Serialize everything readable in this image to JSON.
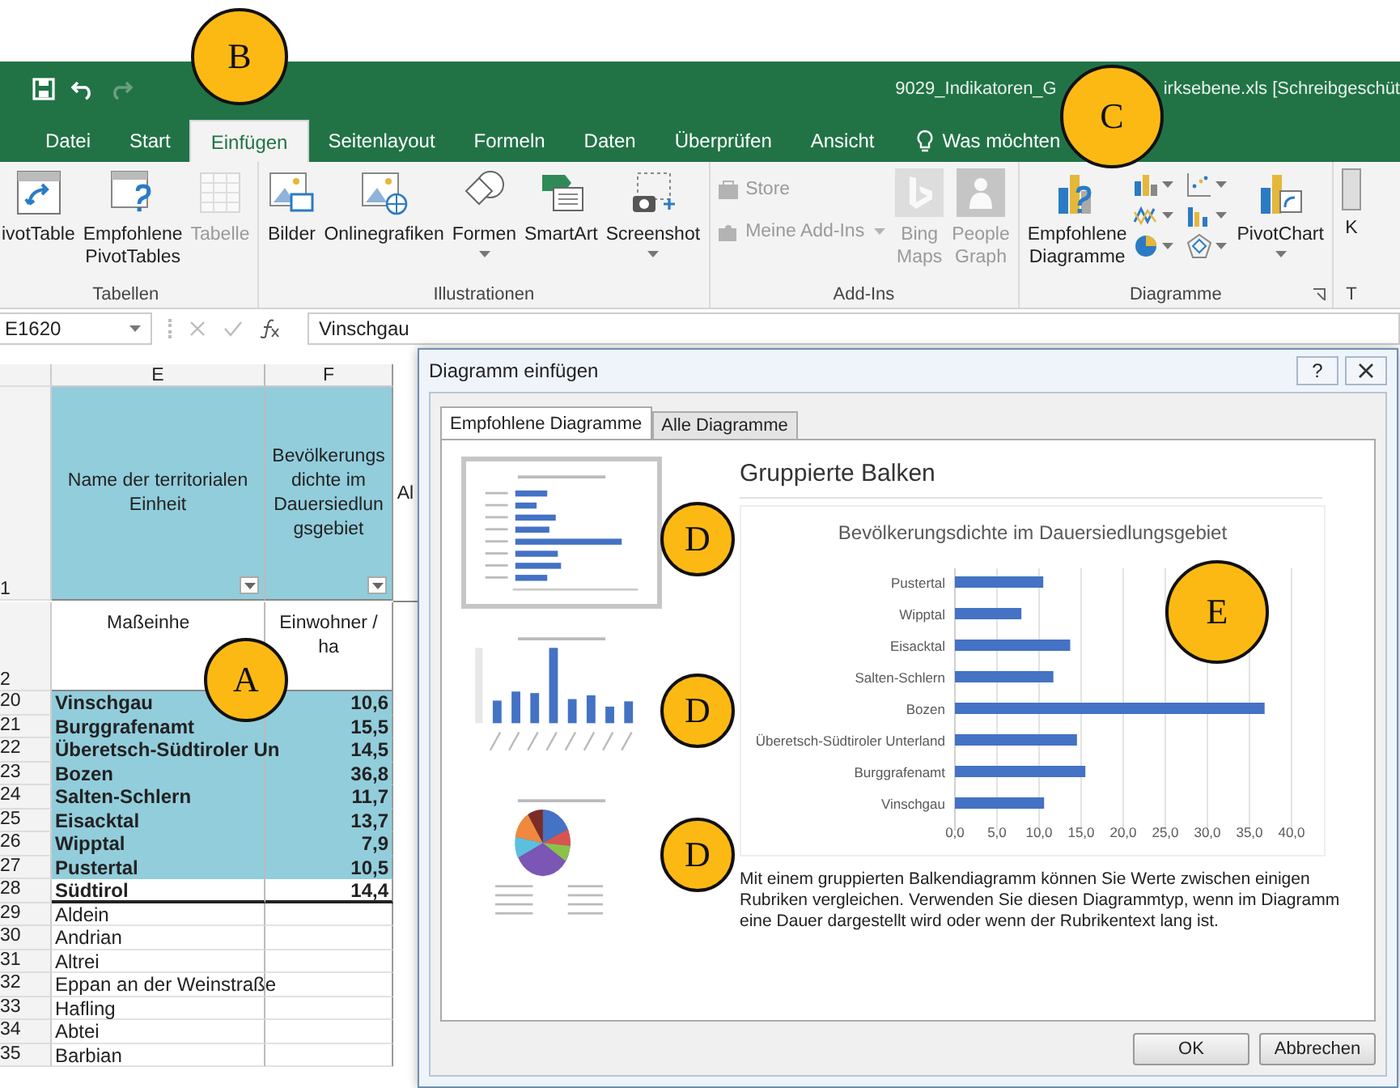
{
  "title_bar": {
    "title_parts": [
      "9029_Indikatoren_G",
      "irksebene.xls  [Schreibgeschüt"
    ]
  },
  "quick_access": [
    {
      "kind": "save",
      "disabled": false
    },
    {
      "kind": "undo",
      "disabled": false
    },
    {
      "kind": "redo",
      "disabled": true
    }
  ],
  "tabs": [
    {
      "label": "Datei",
      "selected": false
    },
    {
      "label": "Start",
      "selected": false
    },
    {
      "label": "Einfügen",
      "selected": true
    },
    {
      "label": "Seitenlayout",
      "selected": false
    },
    {
      "label": "Formeln",
      "selected": false
    },
    {
      "label": "Daten",
      "selected": false
    },
    {
      "label": "Überprüfen",
      "selected": false
    },
    {
      "label": "Ansicht",
      "selected": false
    }
  ],
  "tell_me": "Was möchten",
  "ribbon": {
    "groups": [
      {
        "label": "Tabellen",
        "items": [
          {
            "kind": "large",
            "lines": [
              "ivotTable"
            ],
            "disabled": false,
            "dropdown": false
          },
          {
            "kind": "large",
            "lines": [
              "Empfohlene",
              "PivotTables"
            ],
            "disabled": false,
            "dropdown": false
          },
          {
            "kind": "large",
            "lines": [
              "Tabelle"
            ],
            "disabled": true,
            "dropdown": false
          }
        ]
      },
      {
        "label": "Illustrationen",
        "items": [
          {
            "kind": "large",
            "lines": [
              "Bilder"
            ],
            "disabled": false,
            "dropdown": false
          },
          {
            "kind": "large",
            "lines": [
              "Onlinegrafiken"
            ],
            "disabled": false,
            "dropdown": false
          },
          {
            "kind": "large",
            "lines": [
              "Formen"
            ],
            "disabled": false,
            "dropdown": true
          },
          {
            "kind": "large",
            "lines": [
              "SmartArt"
            ],
            "disabled": false,
            "dropdown": false
          },
          {
            "kind": "large",
            "lines": [
              "Screenshot"
            ],
            "disabled": false,
            "dropdown": true
          }
        ]
      },
      {
        "label": "Add-Ins",
        "items": [
          {
            "kind": "stack",
            "disabled": true,
            "entries": [
              {
                "label": "Store",
                "dropdown": false
              },
              {
                "label": "Meine Add-Ins",
                "dropdown": true
              }
            ]
          },
          {
            "kind": "large",
            "lines": [
              "Bing",
              "Maps"
            ],
            "disabled": true,
            "dropdown": false
          },
          {
            "kind": "large",
            "lines": [
              "People",
              "Graph"
            ],
            "disabled": true,
            "dropdown": false
          }
        ]
      },
      {
        "label": "Diagramme",
        "launcher": true,
        "items": [
          {
            "kind": "large",
            "lines": [
              "Empfohlene",
              "Diagramme"
            ],
            "disabled": false,
            "dropdown": false
          },
          {
            "kind": "chart_icons"
          },
          {
            "kind": "large",
            "lines": [
              "PivotChart"
            ],
            "disabled": false,
            "dropdown": true
          }
        ]
      },
      {
        "label": "T",
        "items": [
          {
            "kind": "large",
            "lines": [
              "K"
            ],
            "disabled": false,
            "dropdown": false
          }
        ]
      }
    ]
  },
  "formula_bar": {
    "name_box": "E1620",
    "value": "Vinschgau"
  },
  "sheet": {
    "columns": [
      "E",
      "F"
    ],
    "header_rows": [
      {
        "row": "1",
        "cells": [
          [
            "Name der territorialen",
            "Einheit"
          ],
          [
            "Bevölkerungs",
            "dichte im",
            "Dauersiedlun",
            "gsgebiet"
          ],
          [
            "Al"
          ]
        ],
        "filter": true
      },
      {
        "row": "2",
        "cells": [
          [
            "Maßeinhe"
          ],
          [
            "Einwohner /",
            "ha"
          ]
        ],
        "filter": false
      }
    ],
    "rows": [
      {
        "row": "20",
        "name": "Vinschgau",
        "value": "10,6",
        "highlight": true,
        "bold": true
      },
      {
        "row": "21",
        "name": "Burggrafenamt",
        "value": "15,5",
        "highlight": true,
        "bold": true
      },
      {
        "row": "22",
        "name": "Überetsch-Südtiroler Un",
        "value": "14,5",
        "highlight": true,
        "bold": true
      },
      {
        "row": "23",
        "name": "Bozen",
        "value": "36,8",
        "highlight": true,
        "bold": true
      },
      {
        "row": "24",
        "name": "Salten-Schlern",
        "value": "11,7",
        "highlight": true,
        "bold": true
      },
      {
        "row": "25",
        "name": "Eisacktal",
        "value": "13,7",
        "highlight": true,
        "bold": true
      },
      {
        "row": "26",
        "name": "Wipptal",
        "value": "7,9",
        "highlight": true,
        "bold": true
      },
      {
        "row": "27",
        "name": "Pustertal",
        "value": "10,5",
        "highlight": true,
        "bold": true
      },
      {
        "row": "28",
        "name": "Südtirol",
        "value": "14,4",
        "highlight": false,
        "bold": true
      },
      {
        "row": "29",
        "name": "Aldein",
        "highlight": false,
        "bold": false
      },
      {
        "row": "30",
        "name": "Andrian",
        "highlight": false,
        "bold": false
      },
      {
        "row": "31",
        "name": "Altrei",
        "highlight": false,
        "bold": false
      },
      {
        "row": "32",
        "name": "Eppan an der Weinstraße",
        "highlight": false,
        "bold": false
      },
      {
        "row": "33",
        "name": "Hafling",
        "highlight": false,
        "bold": false
      },
      {
        "row": "34",
        "name": "Abtei",
        "highlight": false,
        "bold": false
      },
      {
        "row": "35",
        "name": "Barbian",
        "highlight": false,
        "bold": false
      }
    ]
  },
  "dialog": {
    "title": "Diagramm einfügen",
    "help": "?",
    "tabs": [
      {
        "label": "Empfohlene Diagramme",
        "selected": true
      },
      {
        "label": "Alle Diagramme",
        "selected": false
      }
    ],
    "thumbnails": [
      {
        "kind": "bar",
        "selected": true
      },
      {
        "kind": "column",
        "selected": false
      },
      {
        "kind": "pie",
        "selected": false
      }
    ],
    "preview": {
      "heading": "Gruppierte Balken",
      "chart_data": {
        "type": "bar",
        "orientation": "horizontal",
        "title": "Bevölkerungsdichte im Dauersiedlungsgebiet",
        "grid": true,
        "categories": [
          "Pustertal",
          "Wipptal",
          "Eisacktal",
          "Salten-Schlern",
          "Bozen",
          "Überetsch-Südtiroler Unterland",
          "Burggrafenamt",
          "Vinschgau"
        ],
        "series": [
          {
            "color": "#4472c4",
            "values": [
              10.5,
              7.9,
              13.7,
              11.7,
              36.8,
              14.5,
              15.5,
              10.6
            ]
          }
        ],
        "xlim": [
          0,
          40
        ],
        "xticks": [
          {
            "value": 0,
            "label": "0,0"
          },
          {
            "value": 5,
            "label": "5,0"
          },
          {
            "value": 10,
            "label": "10,0"
          },
          {
            "value": 15,
            "label": "15,0"
          },
          {
            "value": 20,
            "label": "20,0"
          },
          {
            "value": 25,
            "label": "25,0"
          },
          {
            "value": 30,
            "label": "30,0"
          },
          {
            "value": 35,
            "label": "35,0"
          },
          {
            "value": 40,
            "label": "40,0"
          }
        ]
      }
    },
    "description": "Mit einem gruppierten Balkendiagramm können Sie Werte zwischen einigen Rubriken vergleichen. Verwenden Sie diesen Diagrammtyp, wenn im Diagramm eine Dauer dargestellt wird oder wenn der Rubrikentext lang ist.",
    "buttons": [
      "OK",
      "Abbrechen"
    ]
  },
  "callouts": [
    {
      "letter": "B"
    },
    {
      "letter": "C"
    },
    {
      "letter": "A"
    },
    {
      "letter": "D"
    },
    {
      "letter": "D"
    },
    {
      "letter": "D"
    },
    {
      "letter": "E"
    }
  ]
}
